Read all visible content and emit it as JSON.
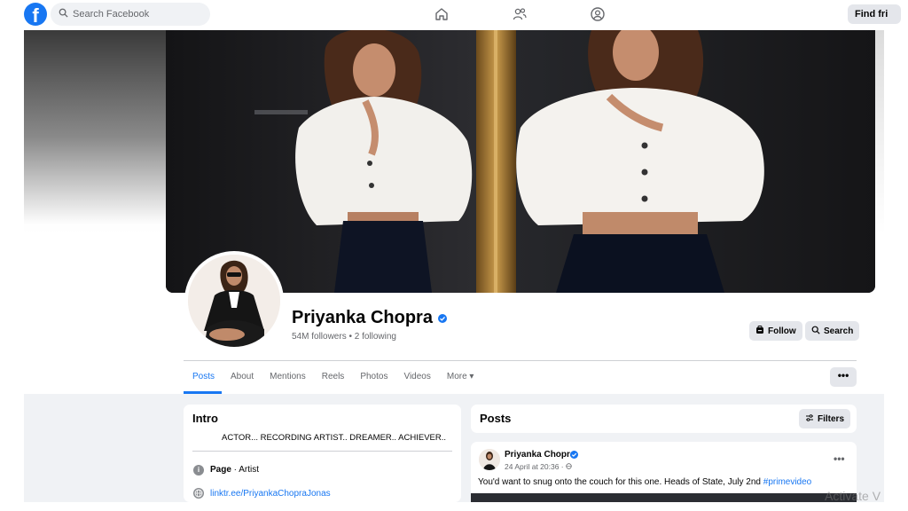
{
  "topbar": {
    "logo": "f",
    "search_placeholder": "Search Facebook",
    "find_friends_label": "Find fri"
  },
  "icons": {
    "search": "search-icon",
    "home": "home-icon",
    "friends": "friends-icon",
    "profile": "profile-circle-icon",
    "verified": "verified-badge-icon",
    "messenger": "messenger-icon",
    "info": "info-icon",
    "link": "globe-icon",
    "filters": "filters-icon"
  },
  "profile": {
    "name": "Priyanka Chopra",
    "stats": "54M followers • 2 following",
    "follow_label": "Follow",
    "search_label": "Search"
  },
  "tabs": [
    {
      "label": "Posts",
      "active": true
    },
    {
      "label": "About"
    },
    {
      "label": "Mentions"
    },
    {
      "label": "Reels"
    },
    {
      "label": "Photos"
    },
    {
      "label": "Videos"
    },
    {
      "label": "More ▾"
    }
  ],
  "more_button": "•••",
  "intro": {
    "title": "Intro",
    "bio": "ACTOR... RECORDING ARTIST.. DREAMER.. ACHIEVER..",
    "category_label": "Page",
    "category_value": " · Artist",
    "link": "linktr.ee/PriyankaChopraJonas"
  },
  "posts": {
    "title": "Posts",
    "filters_label": "Filters",
    "post": {
      "author": "Priyanka Chopra",
      "time": "24 April at 20:36 · ",
      "text": "You'd want to snug onto the couch for this one. Heads of State, July 2nd ",
      "hashtag": "#primevideo",
      "menu": "•••"
    }
  },
  "watermark": "Activate V",
  "colors": {
    "brand": "#1877f2",
    "page_bg": "#f0f2f5",
    "button_bg": "#e4e6eb",
    "secondary_text": "#65676b"
  }
}
